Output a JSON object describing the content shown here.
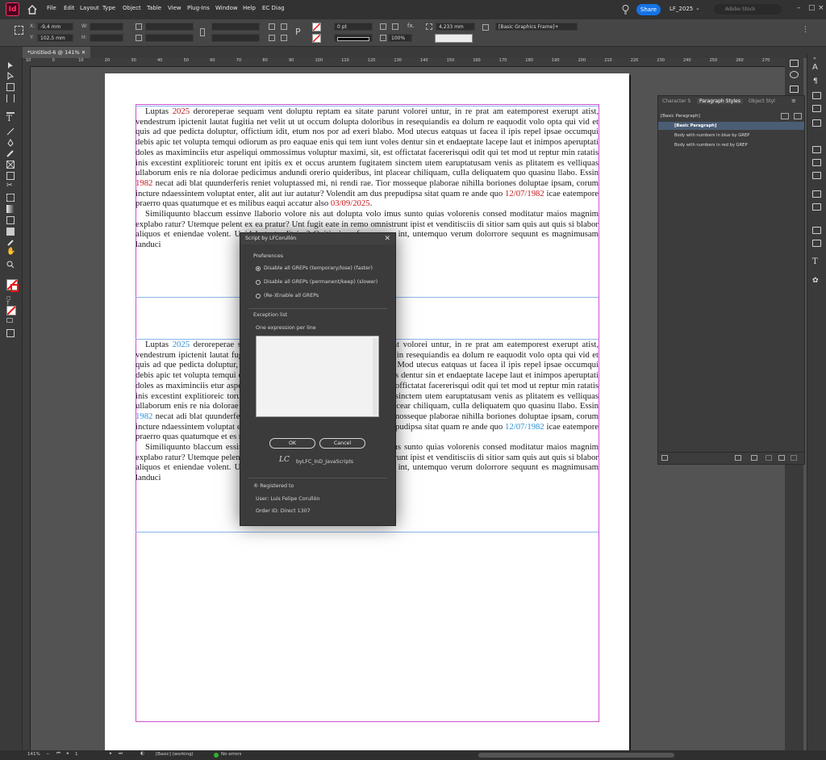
{
  "app": {
    "logo": "Id",
    "workspace": "LF_2025",
    "share": "Share",
    "search_placeholder": "Adobe Stock"
  },
  "menu": [
    "File",
    "Edit",
    "Layout",
    "Type",
    "Object",
    "Table",
    "View",
    "Plug-Ins",
    "Window",
    "Help",
    "EC Diag"
  ],
  "control": {
    "x": "-9,4 mm",
    "y": "102,5 mm",
    "w_label": "W:",
    "h_label": "H:",
    "x_label": "X:",
    "y_label": "Y:",
    "stroke_weight": "0 pt",
    "zoom_pct": "100%",
    "dim": "4,233 mm",
    "frame_style": "[Basic Graphics Frame]+"
  },
  "tab": {
    "title": "*Untitled-6 @ 141%"
  },
  "ruler_ticks": [
    "10",
    "0",
    "10",
    "20",
    "30",
    "40",
    "50",
    "60",
    "70",
    "80",
    "90",
    "100",
    "110",
    "120",
    "130",
    "140",
    "150",
    "160",
    "170",
    "180",
    "190",
    "200",
    "210",
    "220",
    "230",
    "240",
    "250",
    "260",
    "270"
  ],
  "text": {
    "p1_a": "Luptas ",
    "p1_year": "2025",
    "p1_b": " deroreperae sequam vent doluptu reptam ea sitate parunt volorei untur, in re prat am eatemporest exerupt atist, vendestrum ipictenit lautat fugitia net velit ut ut occum dolupta doloribus in resequiandis ea dolum re eaquodit volo opta qui vid et quis ad que pedicta doluptur, offictium idit, etum nos por ad exeri blabo. Mod utecus eatquas ut facea il ipis repel ipsae occumqui debis apic tet volupta temqui odiorum as pro eaquae enis qui tem iunt voles dentur sin et endaeptate lacepe laut et inimpos aperuptati doles as maximinciis etur aspeliqui ommossimus voluptur maximi, sit, est offictatat facererisqui odit qui tet mod ut reptur min ratatis inis excestint explitioreic torunt ent ipitis ex et occus aruntem fugitatem sinctem utem earuptatusam venis as plitatem es velliquas ullaborum enis re nia dolorae pedicimus andundi orerio quideribus, int placear chiliquam, culla deliquatem quo quasinu llabo. Essin ",
    "p1_year2": "1982",
    "p1_c": " necat adi blat quunderferis reniet voluptassed mi, ni rendi rae. Tior mosseque plaborae nihilla boriones doluptae ipsam, corum incture ndaessintem voluptat enter, alit aut iur autatur? Volendit am dus prepudipsa sitat quam re ande quo ",
    "p1_date1": "12/07/1982",
    "p1_d": " icae eatempore praerro quas quatumque et es milibus eaqui accatur also ",
    "p1_date2": "03/09/2025",
    "p1_e": ".",
    "p2": "Similiquunto blaccum essinve llaborio volore nis aut dolupta volo imus sunto quias volorenis consed moditatur maios magnim explabo ratur? Utemque pelent ex ea pratur? Unt fugit eate in remo omnistrunt ipist et venditisciis di sitior sam quis aut quis si blabor aliquos et eniendae volent. Upidel et et adit iur? Ovitio inverferum sum int, untemquo verum dolorrore sequunt es magnimusam landuci"
  },
  "panel": {
    "tabs": [
      "Character S",
      "Paragraph Styles",
      "Object Styl"
    ],
    "current": "[Basic Paragraph]",
    "styles": [
      "[Basic Paragraph]",
      "Body with numbers in blue by GREP",
      "Body with numbers in red by GREP"
    ]
  },
  "dialog": {
    "title": "Script by LFCorullón",
    "preferences_label": "Preferences",
    "options": [
      "Disable all GREPs (temporary/lose) (faster)",
      "Disable all GREPs (permanent/keep) (slower)",
      "(Re-)Enable all GREPs"
    ],
    "selected_option": 0,
    "exception_label": "Exception list",
    "exception_hint": "One expression per line",
    "exception_value": "",
    "ok": "OK",
    "cancel": "Cancel",
    "brand": "byLFC_InD_JavaScripts",
    "registered": "® Registered to",
    "user": "User: Luis Felipe Corullón",
    "order": "Order ID: Direct 1307"
  },
  "status": {
    "zoom": "141%",
    "page": "1",
    "style": "[Basic] (working)",
    "errors": "No errors"
  },
  "colors": {
    "accent": "#1473e6",
    "number_red": "#c4161c",
    "number_blue": "#2a8fd6",
    "margin_guide": "#d14fd1"
  }
}
